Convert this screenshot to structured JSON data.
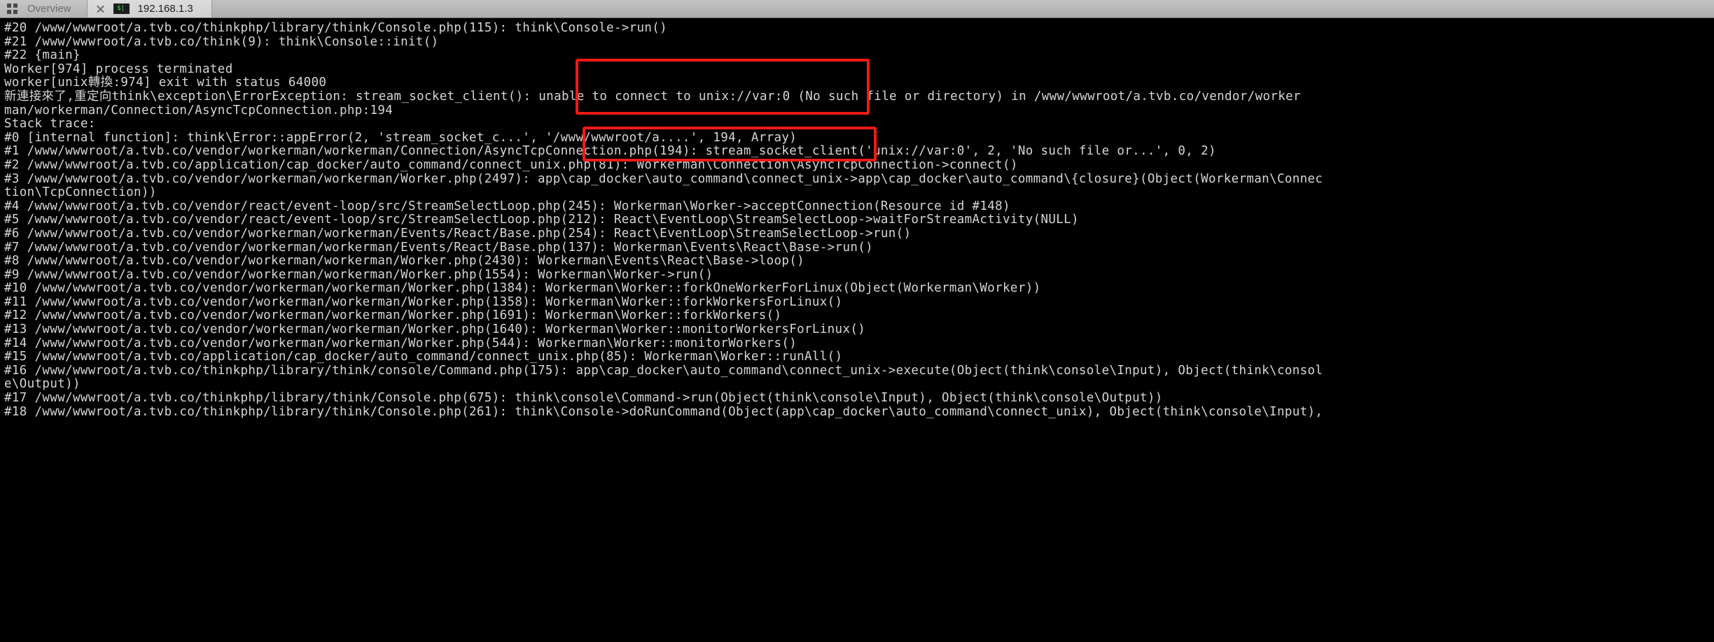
{
  "window": {
    "tabs": [
      {
        "name": "overview",
        "label": "Overview",
        "icon": "grid-icon",
        "active": false
      },
      {
        "name": "session",
        "label": "192.168.1.3",
        "icon": "terminal-icon",
        "active": true,
        "close_label": "×"
      }
    ],
    "terminal_icon_text": "$|"
  },
  "terminal": {
    "background": "#000000",
    "foreground": "#d6d6d6",
    "lines": [
      "#20 /www/wwwroot/a.tvb.co/thinkphp/library/think/Console.php(115): think\\Console->run()",
      "#21 /www/wwwroot/a.tvb.co/think(9): think\\Console::init()",
      "#22 {main}",
      "Worker[974] process terminated",
      "worker[unix轉換:974] exit with status 64000",
      "新連接來了,重定向think\\exception\\ErrorException: stream_socket_client(): unable to connect to unix://var:0 (No such file or directory) in /www/wwwroot/a.tvb.co/vendor/worker",
      "man/workerman/Connection/AsyncTcpConnection.php:194",
      "Stack trace:",
      "#0 [internal function]: think\\Error::appError(2, 'stream_socket_c...', '/www/wwwroot/a....', 194, Array)",
      "#1 /www/wwwroot/a.tvb.co/vendor/workerman/workerman/Connection/AsyncTcpConnection.php(194): stream_socket_client('unix://var:0', 2, 'No such file or...', 0, 2)",
      "#2 /www/wwwroot/a.tvb.co/application/cap_docker/auto_command/connect_unix.php(81): Workerman\\Connection\\AsyncTcpConnection->connect()",
      "#3 /www/wwwroot/a.tvb.co/vendor/workerman/workerman/Worker.php(2497): app\\cap_docker\\auto_command\\connect_unix->app\\cap_docker\\auto_command\\{closure}(Object(Workerman\\Connec",
      "tion\\TcpConnection))",
      "#4 /www/wwwroot/a.tvb.co/vendor/react/event-loop/src/StreamSelectLoop.php(245): Workerman\\Worker->acceptConnection(Resource id #148)",
      "#5 /www/wwwroot/a.tvb.co/vendor/react/event-loop/src/StreamSelectLoop.php(212): React\\EventLoop\\StreamSelectLoop->waitForStreamActivity(NULL)",
      "#6 /www/wwwroot/a.tvb.co/vendor/workerman/workerman/Events/React/Base.php(254): React\\EventLoop\\StreamSelectLoop->run()",
      "#7 /www/wwwroot/a.tvb.co/vendor/workerman/workerman/Events/React/Base.php(137): Workerman\\Events\\React\\Base->run()",
      "#8 /www/wwwroot/a.tvb.co/vendor/workerman/workerman/Worker.php(2430): Workerman\\Events\\React\\Base->loop()",
      "#9 /www/wwwroot/a.tvb.co/vendor/workerman/workerman/Worker.php(1554): Workerman\\Worker->run()",
      "#10 /www/wwwroot/a.tvb.co/vendor/workerman/workerman/Worker.php(1384): Workerman\\Worker::forkOneWorkerForLinux(Object(Workerman\\Worker))",
      "#11 /www/wwwroot/a.tvb.co/vendor/workerman/workerman/Worker.php(1358): Workerman\\Worker::forkWorkersForLinux()",
      "#12 /www/wwwroot/a.tvb.co/vendor/workerman/workerman/Worker.php(1691): Workerman\\Worker::forkWorkers()",
      "#13 /www/wwwroot/a.tvb.co/vendor/workerman/workerman/Worker.php(1640): Workerman\\Worker::monitorWorkersForLinux()",
      "#14 /www/wwwroot/a.tvb.co/vendor/workerman/workerman/Worker.php(544): Workerman\\Worker::monitorWorkers()",
      "#15 /www/wwwroot/a.tvb.co/application/cap_docker/auto_command/connect_unix.php(85): Workerman\\Worker::runAll()",
      "#16 /www/wwwroot/a.tvb.co/thinkphp/library/think/console/Command.php(175): app\\cap_docker\\auto_command\\connect_unix->execute(Object(think\\console\\Input), Object(think\\consol",
      "e\\Output))",
      "#17 /www/wwwroot/a.tvb.co/thinkphp/library/think/Console.php(675): think\\console\\Command->run(Object(think\\console\\Input), Object(think\\console\\Output))",
      "#18 /www/wwwroot/a.tvb.co/thinkphp/library/think/Console.php(261): think\\Console->doRunCommand(Object(app\\cap_docker\\auto_command\\connect_unix), Object(think\\console\\Input),"
    ]
  },
  "annotations": {
    "color": "#f01b13",
    "boxes": [
      {
        "name": "highlight-unable-to-connect",
        "label": "to unix://var:0 (No such file or directory) in"
      },
      {
        "name": "highlight-stream-socket-client",
        "label": "stream_socket_client('unix://var:0', 2, 'No such file or...', 0, 2)"
      }
    ]
  }
}
